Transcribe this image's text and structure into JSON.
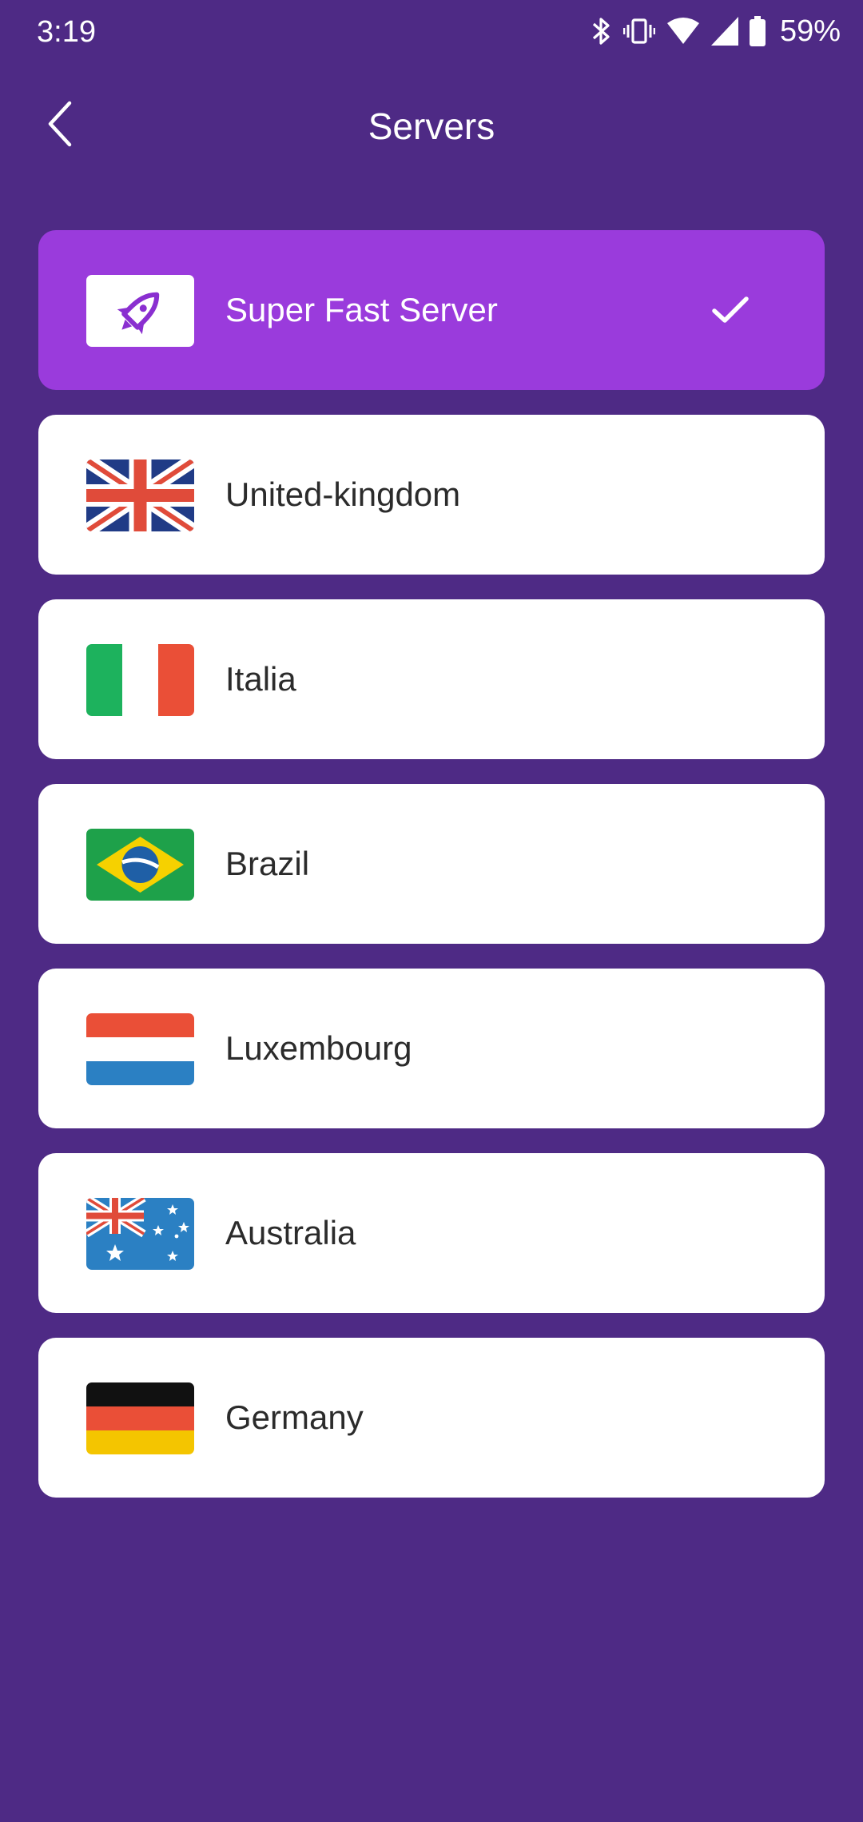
{
  "status_bar": {
    "time": "3:19",
    "battery": "59%",
    "icons": [
      "bluetooth-icon",
      "vibrate-icon",
      "wifi-icon",
      "signal-icon",
      "battery-icon"
    ]
  },
  "header": {
    "title": "Servers",
    "back_icon": "chevron-left-icon"
  },
  "colors": {
    "background": "#4e2a85",
    "selected": "#9a3bdc",
    "card": "#ffffff",
    "text": "#2b2b2b"
  },
  "servers": [
    {
      "label": "Super Fast Server",
      "icon": "rocket-icon",
      "selected": true
    },
    {
      "label": "United-kingdom",
      "icon": "uk-flag-icon",
      "selected": false
    },
    {
      "label": "Italia",
      "icon": "italy-flag-icon",
      "selected": false
    },
    {
      "label": "Brazil",
      "icon": "brazil-flag-icon",
      "selected": false
    },
    {
      "label": "Luxembourg",
      "icon": "luxembourg-flag-icon",
      "selected": false
    },
    {
      "label": "Australia",
      "icon": "australia-flag-icon",
      "selected": false
    },
    {
      "label": "Germany",
      "icon": "germany-flag-icon",
      "selected": false
    }
  ]
}
